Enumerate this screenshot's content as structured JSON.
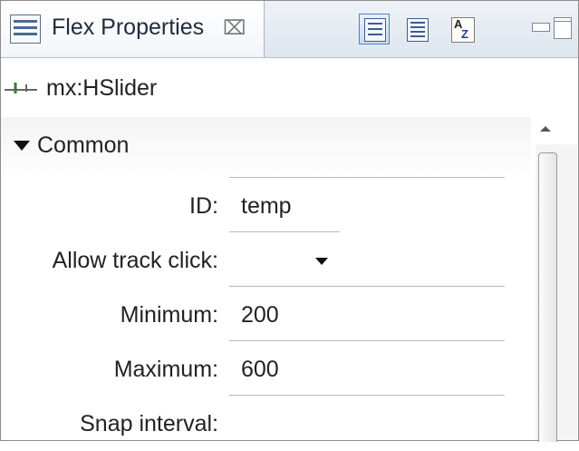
{
  "tab": {
    "title": "Flex Properties",
    "close_glyph": "⌧"
  },
  "toolbar": {
    "buttons": [
      {
        "icon": "standard-view-icon",
        "active": true
      },
      {
        "icon": "category-view-icon",
        "active": false
      },
      {
        "icon": "alphabetical-view-icon",
        "label_a": "A",
        "label_z": "Z",
        "active": false
      }
    ]
  },
  "component": {
    "label": "mx:HSlider",
    "icon": "hslider-icon"
  },
  "section": {
    "label": "Common",
    "expanded": true
  },
  "fields": {
    "id": {
      "label": "ID:",
      "value": "temp"
    },
    "allow_track_click": {
      "label": "Allow track click:",
      "value": ""
    },
    "minimum": {
      "label": "Minimum:",
      "value": "200"
    },
    "maximum": {
      "label": "Maximum:",
      "value": "600"
    },
    "snap_interval": {
      "label": "Snap interval:",
      "value": ""
    }
  },
  "colors": {
    "tab_bg": "#f2f5f9",
    "active_button_border": "#5a7fb5",
    "section_bg": "#f3f3f5"
  }
}
